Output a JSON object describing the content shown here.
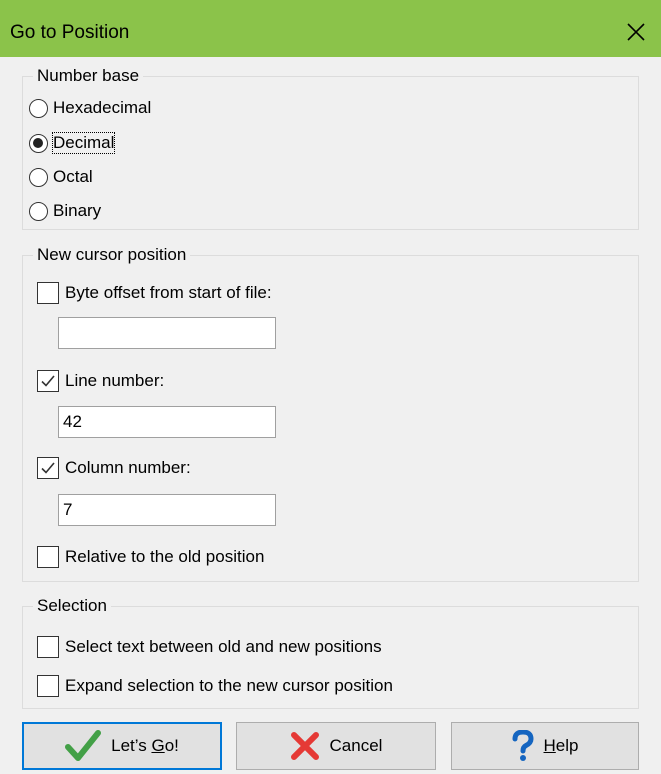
{
  "dialog": {
    "title": "Go to Position"
  },
  "number_base": {
    "legend": "Number base",
    "options": [
      {
        "label": "Hexadecimal",
        "selected": false
      },
      {
        "label": "Decimal",
        "selected": true
      },
      {
        "label": "Octal",
        "selected": false
      },
      {
        "label": "Binary",
        "selected": false
      }
    ]
  },
  "cursor_position": {
    "legend": "New cursor position",
    "byte_offset": {
      "label": "Byte offset from start of file:",
      "checked": false,
      "value": ""
    },
    "line_number": {
      "label": "Line number:",
      "checked": true,
      "value": "42"
    },
    "column_number": {
      "label": "Column number:",
      "checked": true,
      "value": "7"
    },
    "relative": {
      "label": "Relative to the old position",
      "checked": false
    }
  },
  "selection": {
    "legend": "Selection",
    "select_between": {
      "label": "Select text between old and new positions",
      "checked": false
    },
    "expand_selection": {
      "label": "Expand selection to the new cursor position",
      "checked": false
    }
  },
  "buttons": {
    "go": {
      "label_pre": "Let’s ",
      "label_key": "G",
      "label_post": "o!",
      "icon": "checkmark-icon"
    },
    "cancel": {
      "label": "Cancel",
      "icon": "x-icon"
    },
    "help": {
      "label_key": "H",
      "label_post": "elp",
      "icon": "question-icon"
    }
  },
  "colors": {
    "titlebar": "#8bc34a",
    "check_green": "#43a047",
    "cancel_red": "#e53935",
    "help_blue": "#1565c0",
    "focus_border": "#0078d7"
  }
}
